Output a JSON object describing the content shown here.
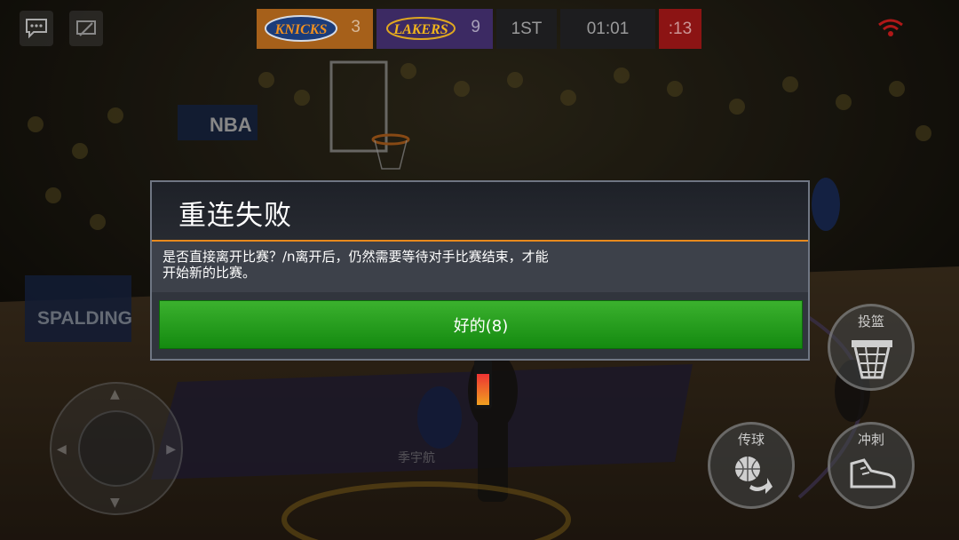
{
  "scoreboard": {
    "home_team": "KNICKS",
    "home_score": "3",
    "away_team": "LAKERS",
    "away_score": "9",
    "period": "1ST",
    "game_clock": "01:01",
    "shot_clock": ":13"
  },
  "arena": {
    "sponsor_banner": "SPALDING",
    "league_logo": "NBA",
    "player_tag": "季宇航"
  },
  "dialog": {
    "title": "重连失败",
    "message": "是否直接离开比赛？/n离开后，仍然需要等待对手比赛结束，才能\n开始新的比赛。",
    "ok_button": "好的(8)"
  },
  "controls": {
    "shoot_label": "投篮",
    "pass_label": "传球",
    "sprint_label": "冲刺"
  },
  "icons": {
    "chat": "chat-icon",
    "screen": "screen-icon",
    "wifi": "wifi-icon",
    "hoop": "basket-hoop-icon",
    "pass": "pass-ball-icon",
    "sprint": "sneaker-icon"
  },
  "colors": {
    "knicks_orange": "#a6601a",
    "lakers_purple": "#3c2a63",
    "shot_clock_red": "#8c1414",
    "dialog_accent": "#e8891c",
    "ok_green": "#2aa023"
  }
}
